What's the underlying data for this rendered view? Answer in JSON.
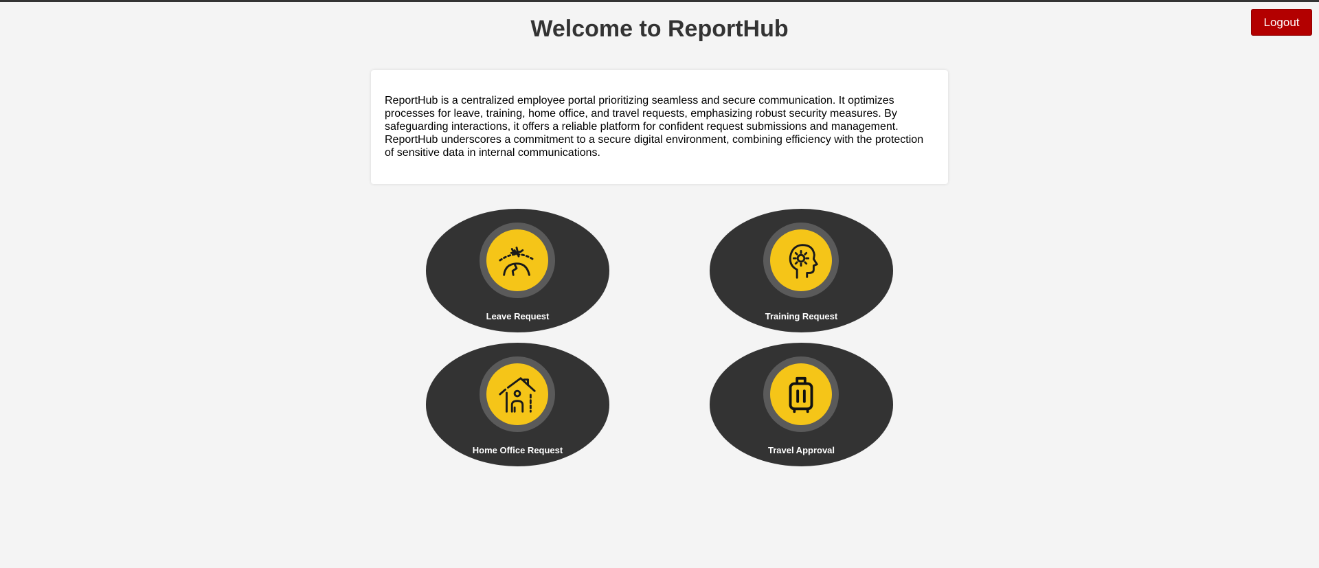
{
  "header": {
    "title": "Welcome to ReportHub",
    "logout_label": "Logout"
  },
  "intro": {
    "text": "ReportHub is a centralized employee portal prioritizing seamless and secure communication. It optimizes processes for leave, training, home office, and travel requests, emphasizing robust security measures. By safeguarding interactions, it offers a reliable platform for confident request submissions and management. ReportHub underscores a commitment to a secure digital environment, combining efficiency with the protection of sensitive data in internal communications."
  },
  "tiles": [
    {
      "label": "Leave Request",
      "icon": "airplane-globe-icon"
    },
    {
      "label": "Training Request",
      "icon": "head-gear-icon"
    },
    {
      "label": "Home Office Request",
      "icon": "house-person-icon"
    },
    {
      "label": "Travel Approval",
      "icon": "luggage-icon"
    }
  ],
  "colors": {
    "background": "#f4f4f4",
    "tile": "#333333",
    "icon_ring": "#5a5a5a",
    "icon_fill": "#f5c518",
    "logout": "#b30000",
    "title": "#333333"
  }
}
